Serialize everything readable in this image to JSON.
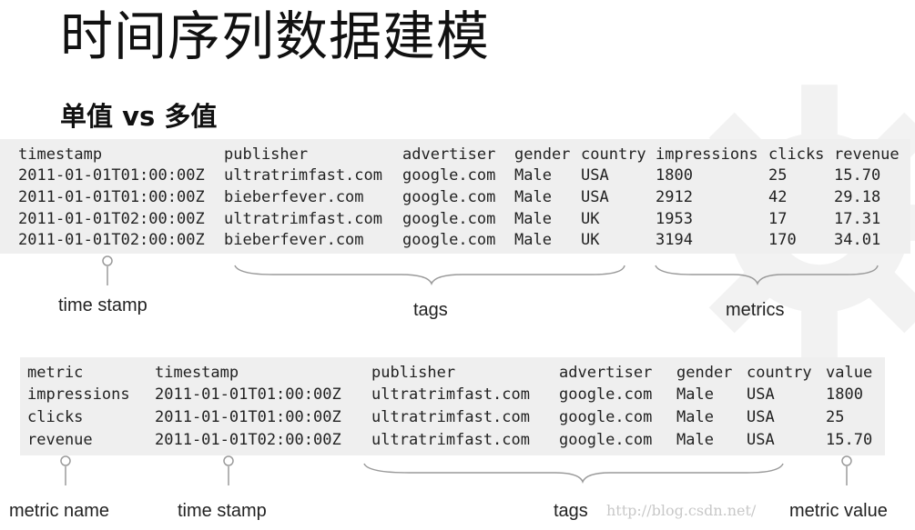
{
  "title": "时间序列数据建模",
  "subtitle": "单值 vs 多值",
  "table1": {
    "headers": [
      "timestamp",
      "publisher",
      "advertiser",
      "gender",
      "country",
      "impressions",
      "clicks",
      "revenue"
    ],
    "rows": [
      [
        "2011-01-01T01:00:00Z",
        "ultratrimfast.com",
        "google.com",
        "Male",
        "USA",
        "1800",
        "25",
        "15.70"
      ],
      [
        "2011-01-01T01:00:00Z",
        "bieberfever.com",
        "google.com",
        "Male",
        "USA",
        "2912",
        "42",
        "29.18"
      ],
      [
        "2011-01-01T02:00:00Z",
        "ultratrimfast.com",
        "google.com",
        "Male",
        "UK",
        "1953",
        "17",
        "17.31"
      ],
      [
        "2011-01-01T02:00:00Z",
        "bieberfever.com",
        "google.com",
        "Male",
        "UK",
        "3194",
        "170",
        "34.01"
      ]
    ]
  },
  "labels1": {
    "timestamp": "time stamp",
    "tags": "tags",
    "metrics": "metrics"
  },
  "table2": {
    "headers": [
      "metric",
      "timestamp",
      "publisher",
      "advertiser",
      "gender",
      "country",
      "value"
    ],
    "rows": [
      [
        "impressions",
        "2011-01-01T01:00:00Z",
        "ultratrimfast.com",
        "google.com",
        "Male",
        "USA",
        "1800"
      ],
      [
        "clicks",
        "2011-01-01T01:00:00Z",
        "ultratrimfast.com",
        "google.com",
        "Male",
        "USA",
        "25"
      ],
      [
        "revenue",
        "2011-01-01T02:00:00Z",
        "ultratrimfast.com",
        "google.com",
        "Male",
        "USA",
        "15.70"
      ]
    ]
  },
  "labels2": {
    "metric_name": "metric name",
    "timestamp": "time stamp",
    "tags": "tags",
    "metric_value": "metric value"
  },
  "watermark": "http://blog.csdn.net/",
  "icons": [
    "gear-icon"
  ]
}
